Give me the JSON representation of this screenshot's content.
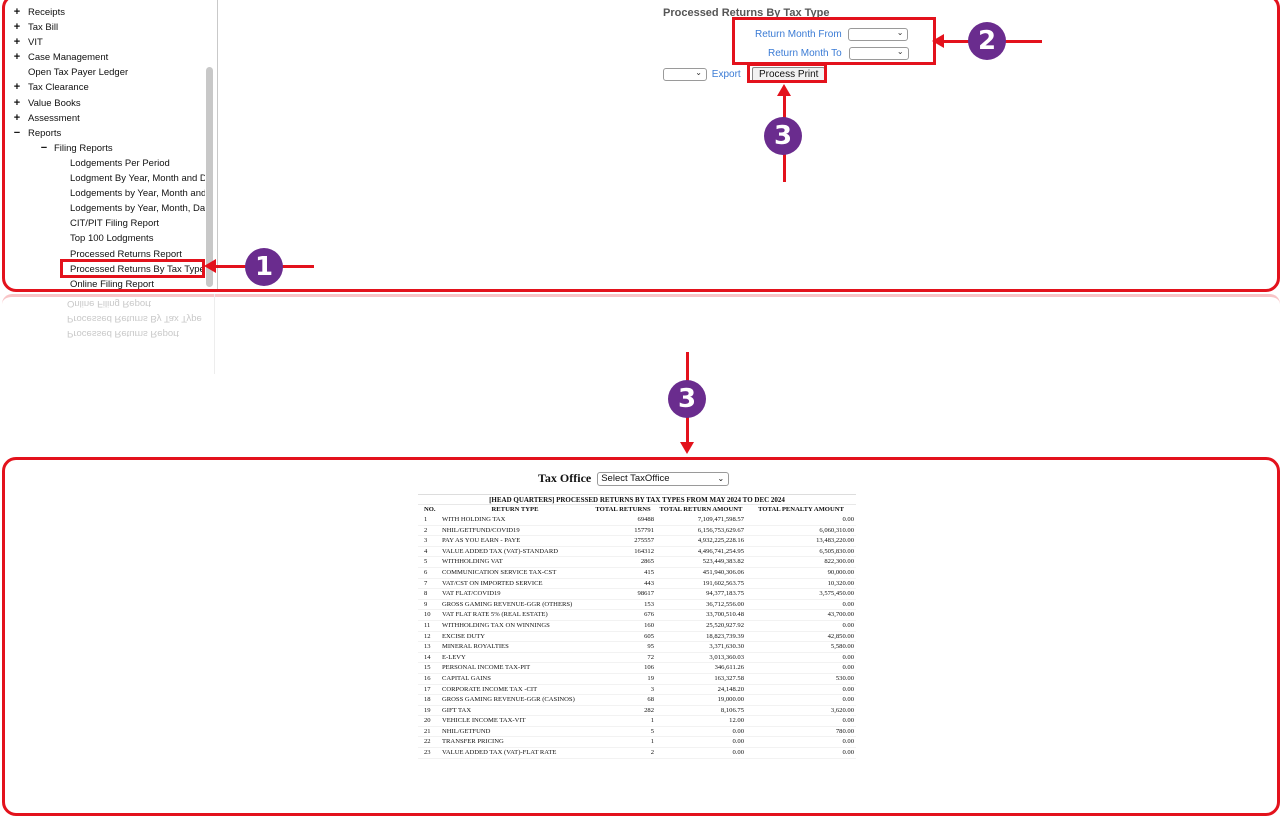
{
  "sidebar": {
    "items": [
      {
        "sign": "+",
        "label": "Receipts",
        "level": 0
      },
      {
        "sign": "+",
        "label": "Tax Bill",
        "level": 0
      },
      {
        "sign": "+",
        "label": "VIT",
        "level": 0
      },
      {
        "sign": "+",
        "label": "Case Management",
        "level": 0
      },
      {
        "sign": "",
        "label": "Open Tax Payer Ledger",
        "level": 0
      },
      {
        "sign": "+",
        "label": "Tax Clearance",
        "level": 0
      },
      {
        "sign": "+",
        "label": "Value Books",
        "level": 0
      },
      {
        "sign": "+",
        "label": "Assessment",
        "level": 0
      },
      {
        "sign": "−",
        "label": "Reports",
        "level": 0
      },
      {
        "sign": "−",
        "label": "Filing Reports",
        "level": 1
      },
      {
        "sign": "",
        "label": "Lodgements Per Period",
        "level": 2
      },
      {
        "sign": "",
        "label": "Lodgment By Year, Month and Da",
        "level": 2
      },
      {
        "sign": "",
        "label": "Lodgements by Year, Month and",
        "level": 2
      },
      {
        "sign": "",
        "label": "Lodgements by Year, Month, Day",
        "level": 2
      },
      {
        "sign": "",
        "label": "CIT/PIT Filing Report",
        "level": 2
      },
      {
        "sign": "",
        "label": "Top 100 Lodgments",
        "level": 2
      },
      {
        "sign": "",
        "label": "Processed Returns Report",
        "level": 2
      },
      {
        "sign": "",
        "label": "Processed Returns By Tax Type",
        "level": 2
      },
      {
        "sign": "",
        "label": "Online Filing Report",
        "level": 2
      }
    ]
  },
  "main": {
    "page_title": "Processed Returns By Tax Type",
    "return_month_from_label": "Return Month From",
    "return_month_to_label": "Return Month To",
    "export_label": "Export",
    "process_print_label": "Process Print"
  },
  "annotations": {
    "badge_1": "1",
    "badge_2": "2",
    "badge_3": "3",
    "badge_3b": "3"
  },
  "report": {
    "tax_office_label": "Tax Office",
    "tax_office_select": "Select TaxOffice",
    "title": "[HEAD QUARTERS] PROCESSED RETURNS BY TAX TYPES FROM MAY 2024 TO DEC 2024",
    "columns": [
      "NO.",
      "RETURN TYPE",
      "TOTAL RETURNS",
      "TOTAL RETURN AMOUNT",
      "TOTAL PENALTY AMOUNT"
    ],
    "rows": [
      [
        "1",
        "WITH HOLDING TAX",
        "69488",
        "7,109,471,598.57",
        "0.00"
      ],
      [
        "2",
        "NHIL/GETFUND/COVID19",
        "157791",
        "6,156,753,629.67",
        "6,060,310.00"
      ],
      [
        "3",
        "PAY AS YOU EARN - PAYE",
        "275557",
        "4,932,225,228.16",
        "13,483,220.00"
      ],
      [
        "4",
        "VALUE ADDED TAX (VAT)-STANDARD",
        "164312",
        "4,496,741,254.95",
        "6,505,830.00"
      ],
      [
        "5",
        "WITHHOLDING VAT",
        "2865",
        "523,449,383.82",
        "822,300.00"
      ],
      [
        "6",
        "COMMUNICATION SERVICE TAX-CST",
        "415",
        "451,940,306.06",
        "90,000.00"
      ],
      [
        "7",
        "VAT/CST ON IMPORTED SERVICE",
        "443",
        "191,602,563.75",
        "10,320.00"
      ],
      [
        "8",
        "VAT FLAT/COVID19",
        "98617",
        "94,377,183.75",
        "3,575,450.00"
      ],
      [
        "9",
        "GROSS GAMING REVENUE-GGR (OTHERS)",
        "153",
        "36,712,556.00",
        "0.00"
      ],
      [
        "10",
        "VAT FLAT RATE 5% (REAL ESTATE)",
        "676",
        "33,700,510.48",
        "43,700.00"
      ],
      [
        "11",
        "WITHHOLDING TAX ON WINNINGS",
        "160",
        "25,520,927.92",
        "0.00"
      ],
      [
        "12",
        "EXCISE DUTY",
        "605",
        "18,823,739.39",
        "42,850.00"
      ],
      [
        "13",
        "MINERAL ROYALTIES",
        "95",
        "3,371,630.30",
        "5,580.00"
      ],
      [
        "14",
        "E-LEVY",
        "72",
        "3,013,360.03",
        "0.00"
      ],
      [
        "15",
        "PERSONAL INCOME TAX-PIT",
        "106",
        "346,611.26",
        "0.00"
      ],
      [
        "16",
        "CAPITAL GAINS",
        "19",
        "163,327.58",
        "530.00"
      ],
      [
        "17",
        "CORPORATE INCOME TAX -CIT",
        "3",
        "24,148.20",
        "0.00"
      ],
      [
        "18",
        "GROSS GAMING REVENUE-GGR (CASINOS)",
        "68",
        "19,000.00",
        "0.00"
      ],
      [
        "19",
        "GIFT TAX",
        "282",
        "8,106.75",
        "3,620.00"
      ],
      [
        "20",
        "VEHICLE INCOME TAX-VIT",
        "1",
        "12.00",
        "0.00"
      ],
      [
        "21",
        "NHIL/GETFUND",
        "5",
        "0.00",
        "780.00"
      ],
      [
        "22",
        "TRANSFER PRICING",
        "1",
        "0.00",
        "0.00"
      ],
      [
        "23",
        "VALUE ADDED TAX (VAT)-FLAT RATE",
        "2",
        "0.00",
        "0.00"
      ]
    ]
  },
  "colors": {
    "annotation_red": "#e3121c",
    "badge_purple": "#6a2c8e",
    "link_blue": "#3a7bd5"
  }
}
